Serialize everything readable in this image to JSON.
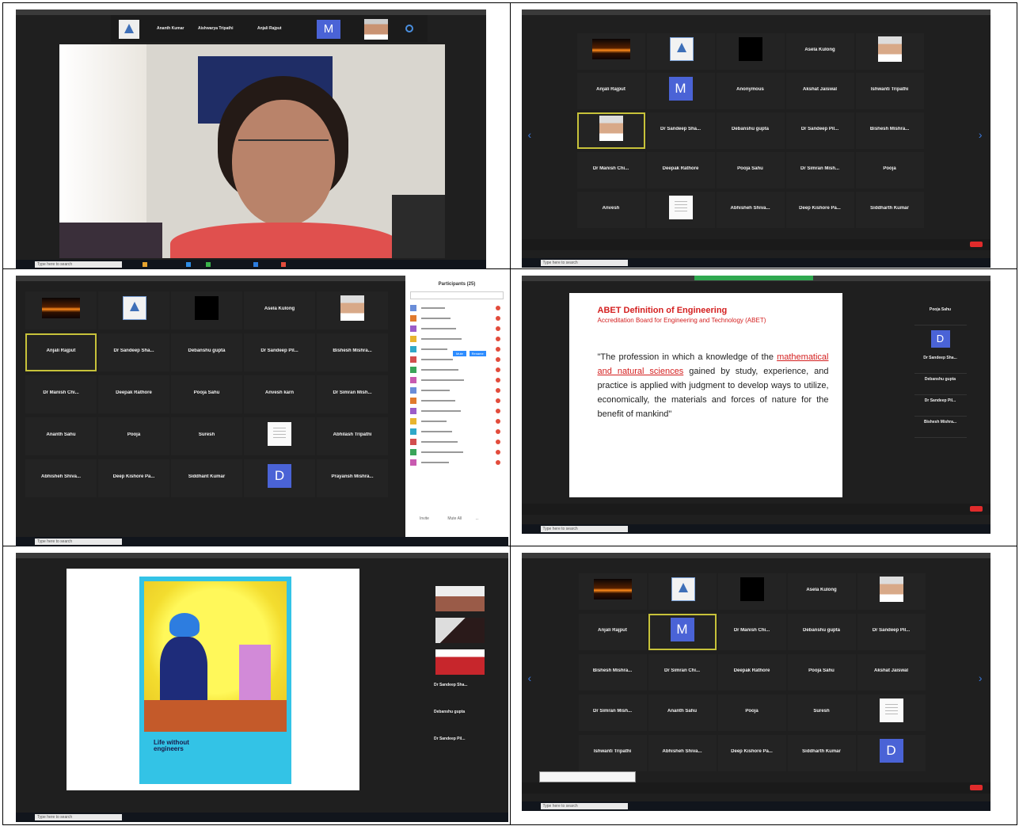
{
  "panels": {
    "p1": {
      "strip": [
        "Ananth Kumar",
        "Aishwarya Tripathi",
        "Anjali Rajput"
      ],
      "avatar_letter": "M",
      "taskbar_search": "Type here to search"
    },
    "p2": {
      "tiles": [
        "",
        "",
        "",
        "Asela Kulong",
        "",
        "Anjali Rajput",
        "M",
        "Anonymous",
        "Akshat Jaiswal",
        "Ishwanti Tripathi",
        "",
        "Dr Sandeep Sha...",
        "Debanshu gupta",
        "Dr Sandeep Pil...",
        "Bishesh Mishra...",
        "Dr Manish Chi...",
        "Deepak Rathore",
        "Pooja Sahu",
        "Dr Simran Mish...",
        "Pooja",
        "Anvesh",
        "",
        "Abhisheh Shiva...",
        "Deep Kishore Pa...",
        "Siddharth Kumar"
      ],
      "taskbar_search": "Type here to search"
    },
    "p3": {
      "tiles": [
        "",
        "",
        "",
        "Asela Kulong",
        "",
        "Anjali Rajput",
        "Dr Sandeep Sha...",
        "Debanshu gupta",
        "Dr Sandeep Pil...",
        "Bishesh Mishra...",
        "Dr Manish Chi...",
        "Deepak Rathore",
        "Pooja Sahu",
        "Anvesh karn",
        "Dr Simran Mish...",
        "Ananth Sahu",
        "Pooja",
        "Suresh",
        "",
        "Abhilash Tripathi",
        "Abhisheh Shiva...",
        "Deep Kishore Pa...",
        "Siddhant Kumar",
        "D",
        "Prayansh Mishra..."
      ],
      "side_title": "Participants (25)",
      "side_buttons": [
        "Mute",
        "Rename"
      ],
      "side_footer": [
        "Invite",
        "Mute All",
        "..."
      ],
      "taskbar_search": "Type here to search"
    },
    "p4": {
      "slide_title": "ABET Definition of Engineering",
      "slide_subtitle": "Accreditation Board for Engineering and Technology (ABET)",
      "slide_body_1": "\"The profession in which a knowledge of the ",
      "slide_body_link": "mathematical and natural sciences",
      "slide_body_2": " gained by study, experience, and practice is applied with judgment to develop ways to utilize, economically, the materials and forces of nature for the benefit of mankind\"",
      "side": [
        "Pooja Sahu",
        "D",
        "Dr Sandeep Sha...",
        "Debanshu gupta",
        "Dr Sandeep Pil...",
        "Bishesh Mishra..."
      ],
      "taskbar_search": "Type here to search"
    },
    "p5": {
      "poster_caption": "Life without engineers",
      "side": [
        "Dr Sandeep Sha...",
        "Debanshu gupta",
        "Dr Sandeep Pil..."
      ],
      "taskbar_search": "Type here to search"
    },
    "p6": {
      "tiles": [
        "",
        "",
        "",
        "Asela Kulong",
        "",
        "Anjali Rajput",
        "M",
        "Dr Manish Chi...",
        "Debanshu gupta",
        "Dr Sandeep Pil...",
        "Bishesh Mishra...",
        "Dr Simran Chi...",
        "Deepak Rathore",
        "Pooja Sahu",
        "Akshat Jaiswal",
        "Dr Simran Mish...",
        "Ananth Sahu",
        "Pooja",
        "Suresh",
        "",
        "Ishwanti Tripathi",
        "Abhisheh Shiva...",
        "Deep Kishore Pa...",
        "Siddharth Kumar",
        "D"
      ],
      "taskbar_search": "Type here to search"
    }
  }
}
